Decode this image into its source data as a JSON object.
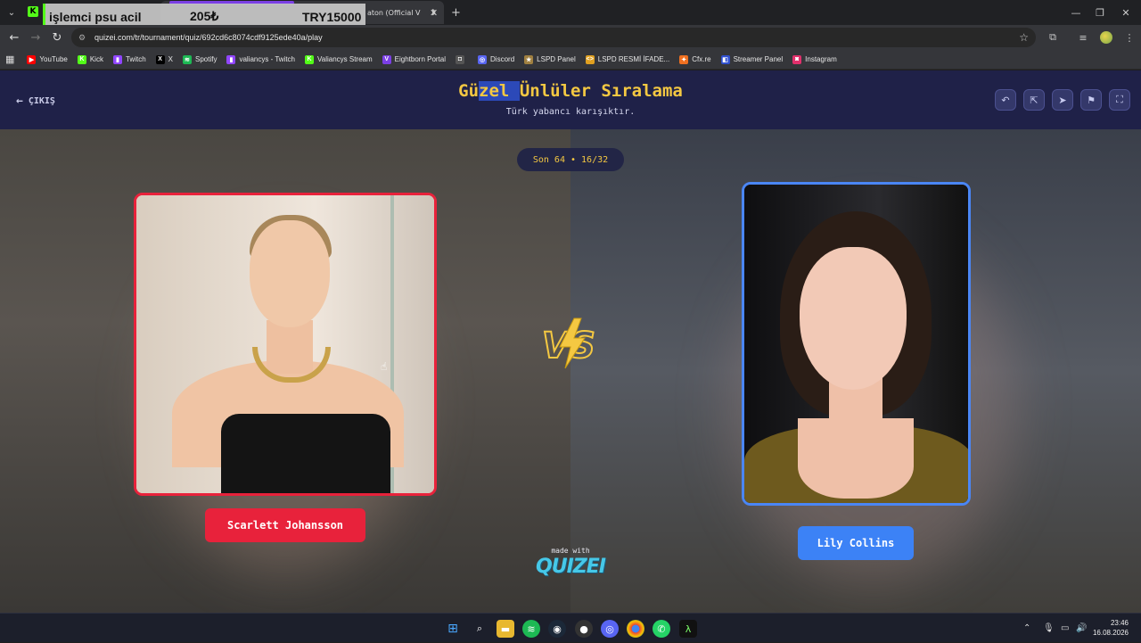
{
  "browser": {
    "tab_active_title": "aton (Official V",
    "overlay": {
      "text": "işlemci psu acil",
      "price_try": "205₺",
      "price_total": "TRY15000"
    },
    "url": "quizei.com/tr/tournament/quiz/692cd6c8074cdf9125ede40a/play",
    "new_tab": "+",
    "bookmarks": [
      {
        "label": "YouTube",
        "icon": "youtube-icon",
        "color": "#ff0000"
      },
      {
        "label": "Kick",
        "icon": "kick-icon",
        "color": "#53fc18"
      },
      {
        "label": "Twitch",
        "icon": "twitch-icon",
        "color": "#9146ff"
      },
      {
        "label": "X",
        "icon": "x-icon",
        "color": "#000000"
      },
      {
        "label": "Spotify",
        "icon": "spotify-icon",
        "color": "#1db954"
      },
      {
        "label": "valiancys - Twitch",
        "icon": "twitch-icon",
        "color": "#9146ff"
      },
      {
        "label": "Valiancys Stream",
        "icon": "kick-icon",
        "color": "#53fc18"
      },
      {
        "label": "Eightborn Portal",
        "icon": "eightborn-icon",
        "color": "#7b3fe4"
      },
      {
        "label": "",
        "icon": "camera-icon",
        "color": "#555555"
      },
      {
        "label": "Discord",
        "icon": "discord-icon",
        "color": "#5865f2"
      },
      {
        "label": "LSPD Panel",
        "icon": "lspd-icon",
        "color": "#a08040"
      },
      {
        "label": "LSPD  RESMİ İFADE...",
        "icon": "code-icon",
        "color": "#e0a020"
      },
      {
        "label": "Cfx.re",
        "icon": "cfx-icon",
        "color": "#f07020"
      },
      {
        "label": "Streamer Panel",
        "icon": "streamer-icon",
        "color": "#3050d0"
      },
      {
        "label": "Instagram",
        "icon": "instagram-icon",
        "color": "#e1306c"
      }
    ]
  },
  "quiz": {
    "exit_label": "ÇIKIŞ",
    "title_pre": "Gü",
    "title_hl": "zel ",
    "title_post": "Ünlüler Sıralama",
    "subtitle": "Türk yabancı karışıktır.",
    "round": "Son 64 • 16/32",
    "left_name": "Scarlett Johansson",
    "right_name": "Lily Collins",
    "vs": "VS",
    "made_with": "made with",
    "brand": "QUIZEI"
  },
  "taskbar": {
    "time": "23:46",
    "date": "16.08.2026"
  }
}
